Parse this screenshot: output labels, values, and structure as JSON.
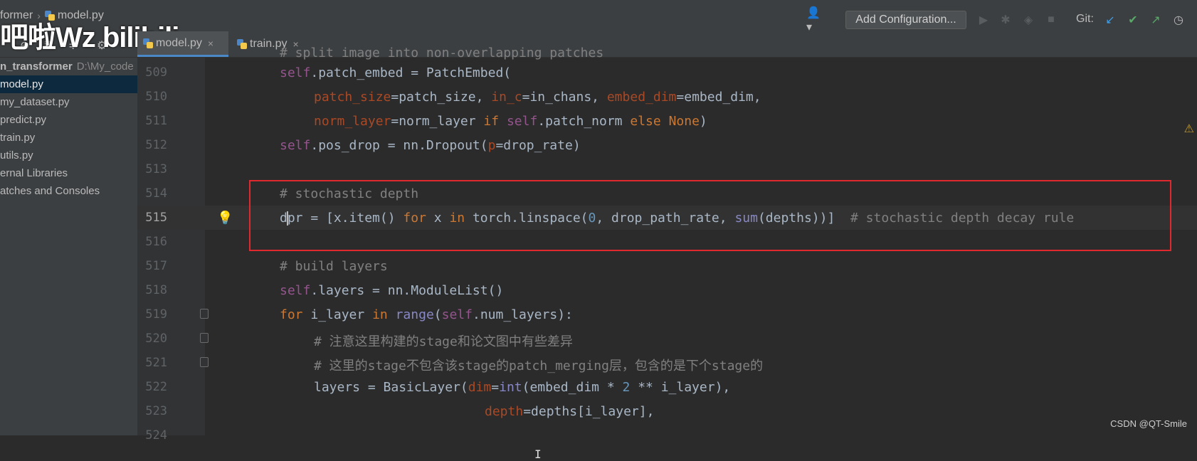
{
  "breadcrumb": {
    "project": "former",
    "file": "model.py"
  },
  "toolbar": {
    "add_configuration": "Add Configuration...",
    "git_label": "Git:"
  },
  "watermark": {
    "text": "吧啦Wz bilibili"
  },
  "tabs": [
    {
      "label": "model.py",
      "active": true
    },
    {
      "label": "train.py",
      "active": false
    }
  ],
  "project_tree": {
    "root_name": "n_transformer",
    "root_path": "D:\\My_code",
    "items": [
      "model.py",
      "my_dataset.py",
      "predict.py",
      "train.py",
      "utils.py",
      "ernal Libraries",
      "atches and Consoles"
    ],
    "selected": "model.py"
  },
  "editor": {
    "partial_top_comment": "# split image into non-overlapping patches",
    "line_numbers": [
      "509",
      "510",
      "511",
      "512",
      "513",
      "514",
      "515",
      "516",
      "517",
      "518",
      "519",
      "520",
      "521",
      "522",
      "523",
      "524"
    ],
    "current_line": "515",
    "highlighted_lines": [
      "514",
      "515",
      "516"
    ]
  },
  "credit": "CSDN @QT-Smile",
  "colors": {
    "keyword": "#cc7832",
    "self": "#94558d",
    "param": "#aa4926",
    "number": "#6897bb",
    "comment": "#808080",
    "highlight_box": "#e0292f"
  }
}
